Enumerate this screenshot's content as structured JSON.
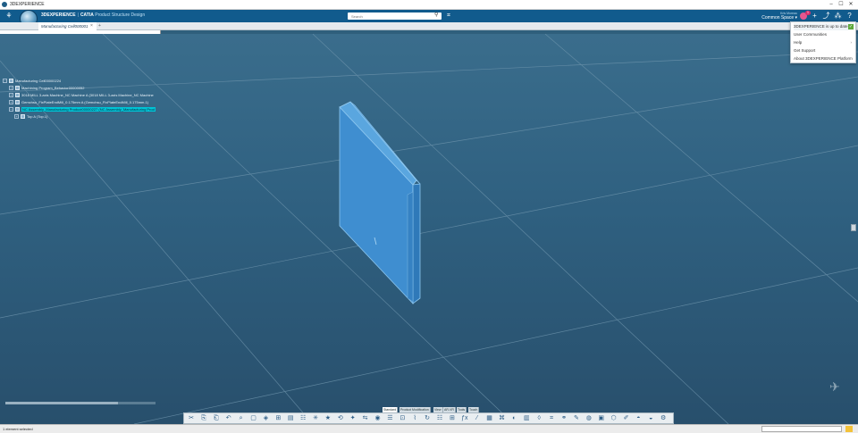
{
  "window": {
    "title": "3DEXPERIENCE",
    "minimize": "–",
    "maximize": "☐",
    "close": "✕"
  },
  "header": {
    "brand": "3DEXPERIENCE",
    "separator": "|",
    "app": "CATIA",
    "app_subtitle": "Product Structure Design",
    "search_placeholder": "Search",
    "user_name": "Kris Moreau",
    "space": "Common Space ▾",
    "notifications_count": "1"
  },
  "tabs": {
    "active_label": "Manufacturing Cell000001",
    "close": "×",
    "add": "+"
  },
  "tree": {
    "nodes": [
      {
        "label": "Manufacturing Cell00000224",
        "expander": "−"
      },
      {
        "label": "Machining Program_Behavior00000052",
        "expander": "+"
      },
      {
        "label": "3018 MILL 3-axis Machine_NC Machine A (3018 MILL 3-axis Machine_NC Machine",
        "expander": "+"
      },
      {
        "label": "Gemchsu_FixPlateEndMill_0.175mm A (Gemchsu_FixPlateEndMill_0.175mm.1)",
        "expander": "+"
      },
      {
        "label": "NC Assembly_Manufacturing Product00000227 (NC Assembly_Manufacturing Prod",
        "expander": "−"
      },
      {
        "label": "Top A (Top.1)",
        "expander": "+"
      }
    ]
  },
  "help_menu": {
    "items": [
      {
        "label": "3DEXPERIENCE is up to date",
        "check": "✓"
      },
      {
        "label": "User Communities"
      },
      {
        "label": "Help",
        "arrow": "›"
      },
      {
        "label": "Get Support"
      },
      {
        "label": "About 3DEXPERIENCE Platform"
      }
    ]
  },
  "action_bar": {
    "section_tabs": [
      "Standard",
      "Product Modification",
      "View",
      "AR-VR",
      "Tools",
      "Touch"
    ],
    "active_section": "Standard",
    "tools": [
      "scissors-icon",
      "copy-icon",
      "paste-icon",
      "undo-icon",
      "zoom-icon",
      "frame-icon",
      "snap-icon",
      "measure-icon",
      "table-icon",
      "catalog-icon",
      "explode-icon",
      "star-icon",
      "reframe-icon",
      "compass-icon",
      "share-icon",
      "capture-icon",
      "tree-icon",
      "assembly-icon",
      "sweep-icon",
      "rotate-icon",
      "layers-icon",
      "structure-icon",
      "formula-icon",
      "parameter-icon",
      "grid-icon",
      "network-icon",
      "section-icon",
      "slider-icon",
      "clash-icon",
      "filter-icon",
      "link-icon",
      "pen-icon",
      "globe-icon",
      "camera-icon",
      "cube-icon",
      "brush-icon",
      "paint-icon",
      "render-icon",
      "settings-icon"
    ]
  },
  "status": {
    "message": "1 element selected"
  },
  "colors": {
    "accent": "#115b8d",
    "selection": "#00c4d6",
    "part": "#3f8ed0",
    "viewport": "#2f5f7c"
  }
}
